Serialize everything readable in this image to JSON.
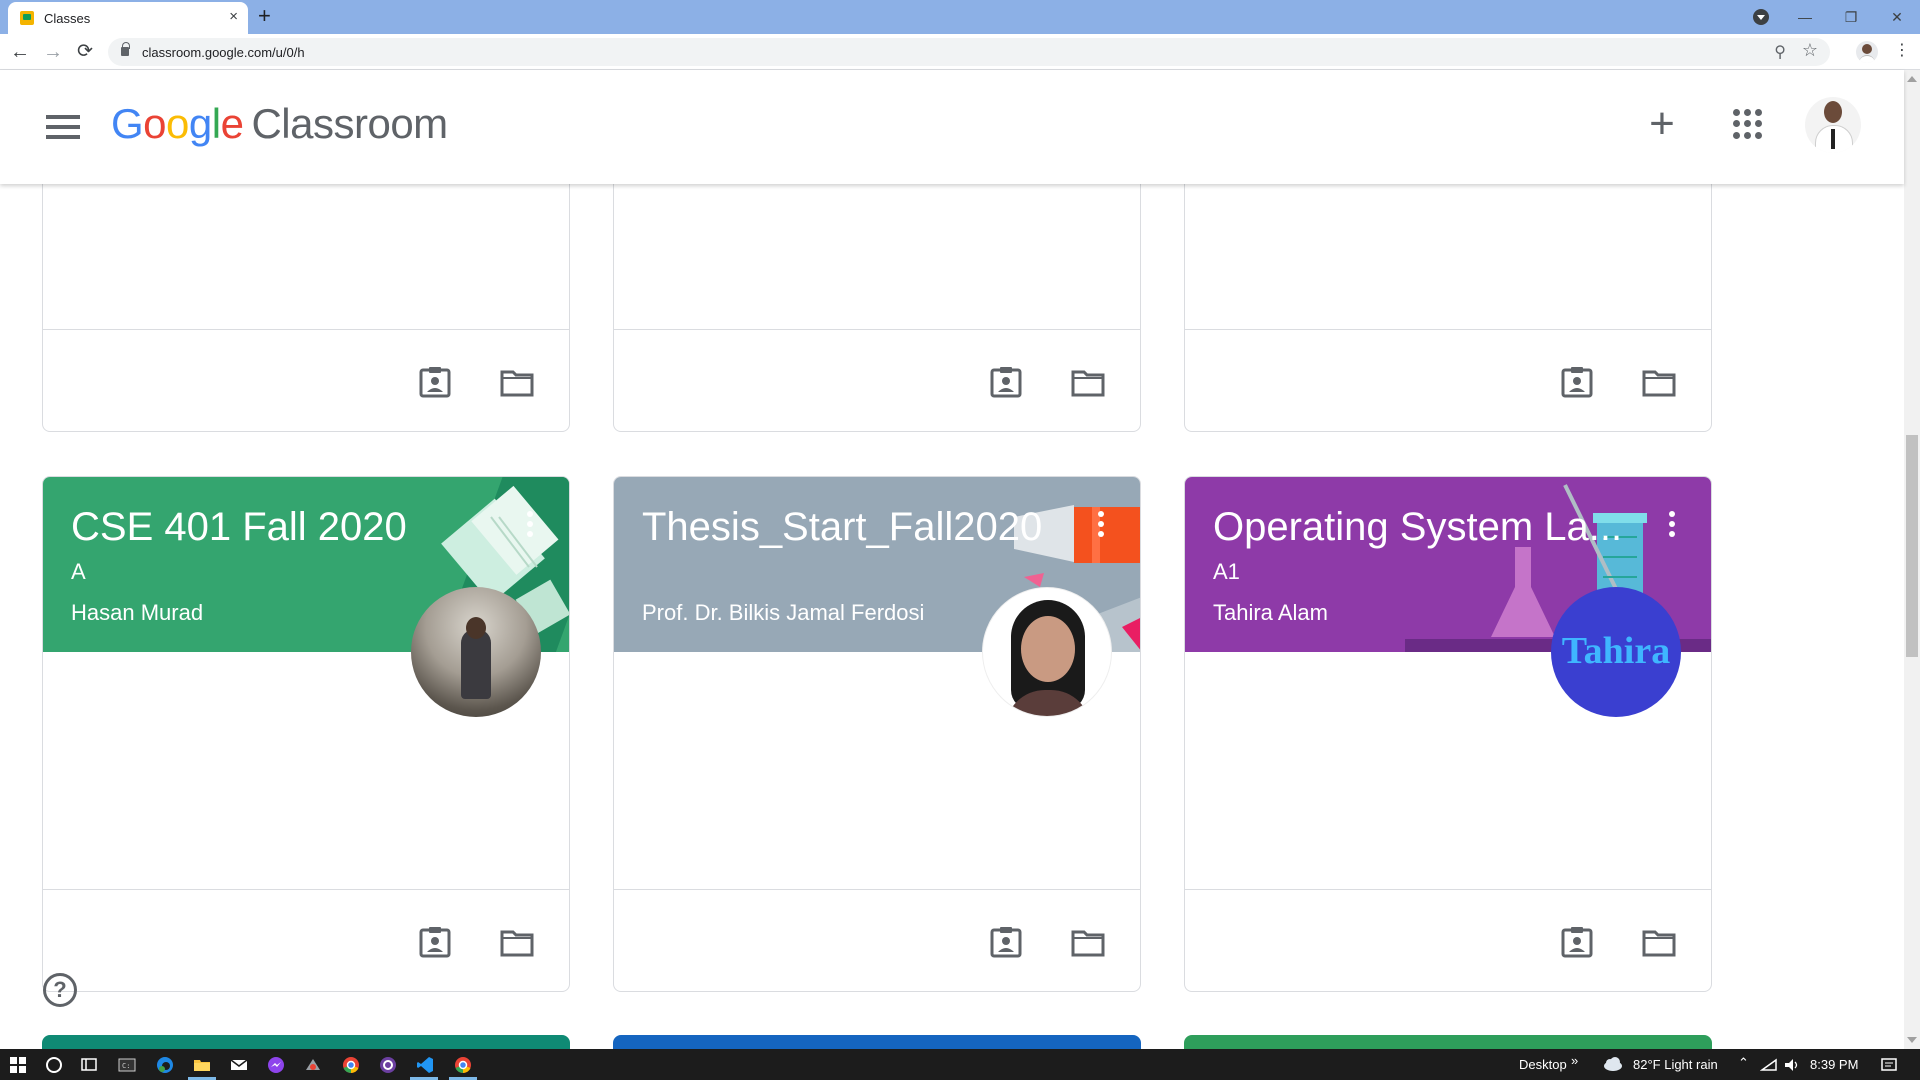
{
  "browser": {
    "tab_title": "Classes",
    "tab_close": "×",
    "new_tab": "+",
    "url": "classroom.google.com/u/0/h",
    "back": "←",
    "forward": "→",
    "reload": "⟳",
    "zoom_glyph": "⚲",
    "star_glyph": "☆",
    "menu_glyph": "⋮",
    "min_glyph": "—",
    "restore_glyph": "❐",
    "close_glyph": "✕"
  },
  "header": {
    "logo_letters": [
      "G",
      "o",
      "o",
      "g",
      "l",
      "e"
    ],
    "product_name": "Classroom",
    "add_glyph": "+"
  },
  "classes": [
    {
      "title": "CSE 401 Fall 2020",
      "section": "A",
      "teacher": "Hasan Murad",
      "banner_color": "#34a56f"
    },
    {
      "title": "Thesis_Start_Fall2020",
      "section": "",
      "teacher": "Prof. Dr. Bilkis Jamal Ferdosi",
      "banner_color": "#97a8b6"
    },
    {
      "title": "Operating System La...",
      "section": "A1",
      "teacher": "Tahira Alam",
      "banner_color": "#8e3aa8",
      "avatar_text": "Tahira"
    }
  ],
  "bottom_strip_colors": [
    "#0f8a74",
    "#1565c0",
    "#2e9e5b"
  ],
  "help_glyph": "?",
  "taskbar": {
    "desktop_label": "Desktop",
    "desktop_chevron": "»",
    "weather": "82°F  Light rain",
    "time": "8:39 PM",
    "tray_glyphs": "⌃"
  }
}
